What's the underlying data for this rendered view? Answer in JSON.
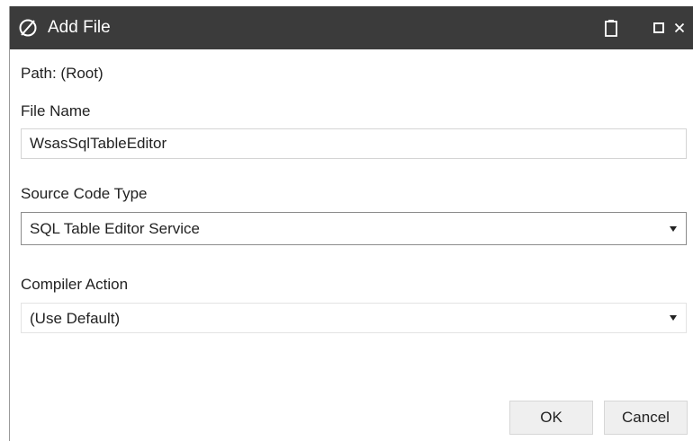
{
  "window": {
    "title": "Add File",
    "logo_icon": "app-logo-icon",
    "controls": [
      "clipboard-icon",
      "maximize-icon",
      "close-icon"
    ],
    "titlebar_color": "#3b3b3b"
  },
  "form": {
    "path_label": "Path:  (Root)",
    "file_name_label": "File Name",
    "file_name_value": "WsasSqlTableEditor",
    "source_type_label": "Source Code Type",
    "source_type_value": "SQL Table Editor Service",
    "compiler_label": "Compiler Action",
    "compiler_value": "(Use Default)"
  },
  "buttons": {
    "ok": "OK",
    "cancel": "Cancel"
  }
}
